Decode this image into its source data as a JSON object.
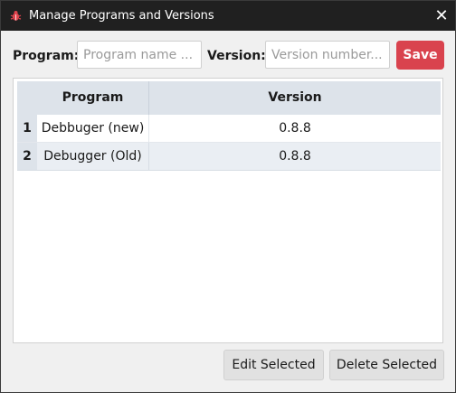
{
  "window": {
    "title": "Manage Programs and Versions",
    "icon": "bug-icon",
    "close_glyph": "✕"
  },
  "form": {
    "program_label": "Program:",
    "program_placeholder": "Program name ...",
    "program_value": "",
    "version_label": "Version:",
    "version_placeholder": "Version number...",
    "version_value": "",
    "save_label": "Save"
  },
  "table": {
    "columns": [
      "Program",
      "Version"
    ],
    "rows": [
      {
        "num": "1",
        "program": "Debbuger (new)",
        "version": "0.8.8"
      },
      {
        "num": "2",
        "program": "Debugger (Old)",
        "version": "0.8.8"
      }
    ]
  },
  "actions": {
    "edit_label": "Edit Selected",
    "delete_label": "Delete Selected"
  },
  "colors": {
    "save_button": "#d9434e",
    "header_bg": "#dde3ea",
    "row_alt_bg": "#eaeef3",
    "titlebar": "#202020"
  }
}
